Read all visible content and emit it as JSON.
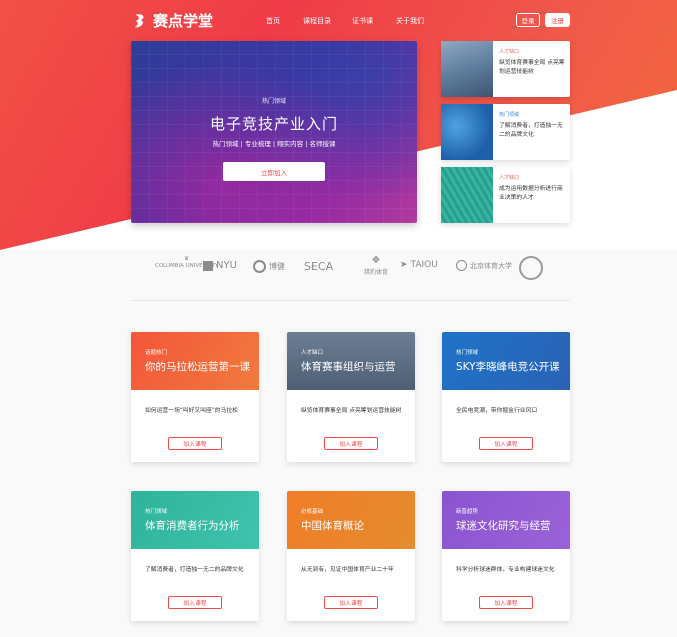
{
  "brand": {
    "name": "赛点学堂"
  },
  "nav": [
    {
      "label": "首页"
    },
    {
      "label": "课程目录"
    },
    {
      "label": "证书课"
    },
    {
      "label": "关于我们"
    }
  ],
  "auth": {
    "login": "登录",
    "register": "注册"
  },
  "hero": {
    "tag": "热门领域",
    "title": "电子竞技产业入门",
    "subtitle": "热门领域 | 专业梳理 | 翔实内容 | 名师授课",
    "cta": "立即加入"
  },
  "side_cards": [
    {
      "tag": "人才缺口",
      "desc": "纵览体育赛事全局 点亮筹划运营技能树",
      "tag_color": "#e9686a"
    },
    {
      "tag": "热门领域",
      "desc": "了解消费者，打造独一无二的品牌文化",
      "tag_color": "#3a8dd9"
    },
    {
      "tag": "人才缺口",
      "desc": "成为运用数据分析进行商业决策的人才",
      "tag_color": "#e9686a"
    }
  ],
  "partners": [
    {
      "label": "COLUMBIA UNIVERSITY"
    },
    {
      "label": "NYU"
    },
    {
      "label": "博健"
    },
    {
      "label": "SECA"
    },
    {
      "label": "猎豹体育"
    },
    {
      "label": "TAIOU"
    },
    {
      "label": "北京体育大学"
    },
    {
      "label": "徽章"
    }
  ],
  "courses": [
    {
      "tag": "话题热门",
      "title": "你的马拉松运营第一课",
      "desc": "如何运营一场“叫好又叫座”的马拉松",
      "button": "加入课程"
    },
    {
      "tag": "人才缺口",
      "title": "体育赛事组织与运营",
      "desc": "纵览体育赛事全局 点亮筹划运营技能树",
      "button": "加入课程"
    },
    {
      "tag": "热门领域",
      "title": "SKY李晓峰电竞公开课",
      "desc": "全民电竞潮，带你掘金行业风口",
      "button": "加入课程"
    },
    {
      "tag": "热门领域",
      "title": "体育消费者行为分析",
      "desc": "了解消费者，打造独一无二的品牌文化",
      "button": "加入课程"
    },
    {
      "tag": "必修基础",
      "title": "中国体育概论",
      "desc": "从无到有，见证中国体育产业二十年",
      "button": "加入课程"
    },
    {
      "tag": "新晋趋势",
      "title": "球迷文化研究与经营",
      "desc": "科学分析球迷群体，专业构建球迷文化",
      "button": "加入课程"
    }
  ],
  "colors": {
    "brand_red": "#ee3e43",
    "orange": "#f36b3a"
  }
}
